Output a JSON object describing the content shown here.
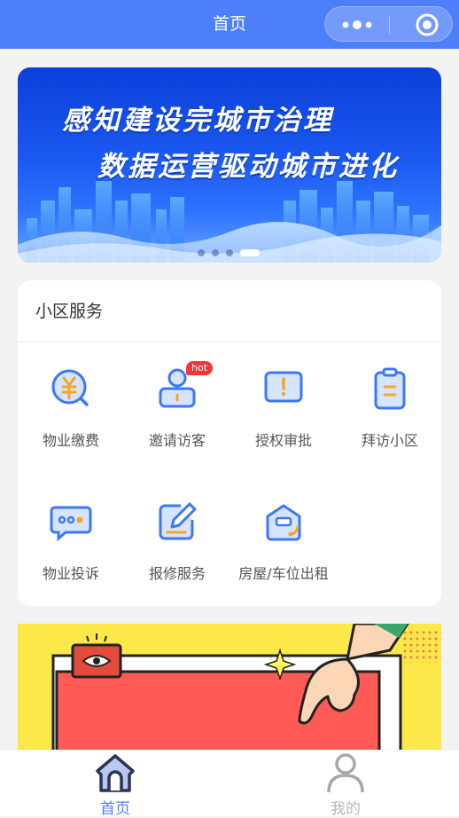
{
  "nav": {
    "title": "首页"
  },
  "banner": {
    "headline_1": "感知建设完城市治理",
    "headline_2": "数据运营驱动城市进化",
    "slide_count": 4,
    "active_slide": 4
  },
  "services": {
    "title": "小区服务",
    "items": [
      {
        "label": "物业缴费",
        "icon": "yuan-coin-icon"
      },
      {
        "label": "邀请访客",
        "icon": "visitor-icon",
        "badge": "hot"
      },
      {
        "label": "授权审批",
        "icon": "approval-icon"
      },
      {
        "label": "拜访小区",
        "icon": "clipboard-icon"
      },
      {
        "label": "物业投诉",
        "icon": "chat-icon"
      },
      {
        "label": "报修服务",
        "icon": "edit-icon"
      },
      {
        "label": "房屋/车位出租",
        "icon": "house-rent-icon"
      }
    ]
  },
  "tabbar": {
    "items": [
      {
        "label": "首页",
        "icon": "home-icon",
        "active": true
      },
      {
        "label": "我的",
        "icon": "user-icon",
        "active": false
      }
    ]
  },
  "colors": {
    "primary": "#4d7ffb",
    "accent_orange": "#f6a623",
    "badge_red": "#f0363c",
    "inactive_tab": "#b8b8b8"
  }
}
